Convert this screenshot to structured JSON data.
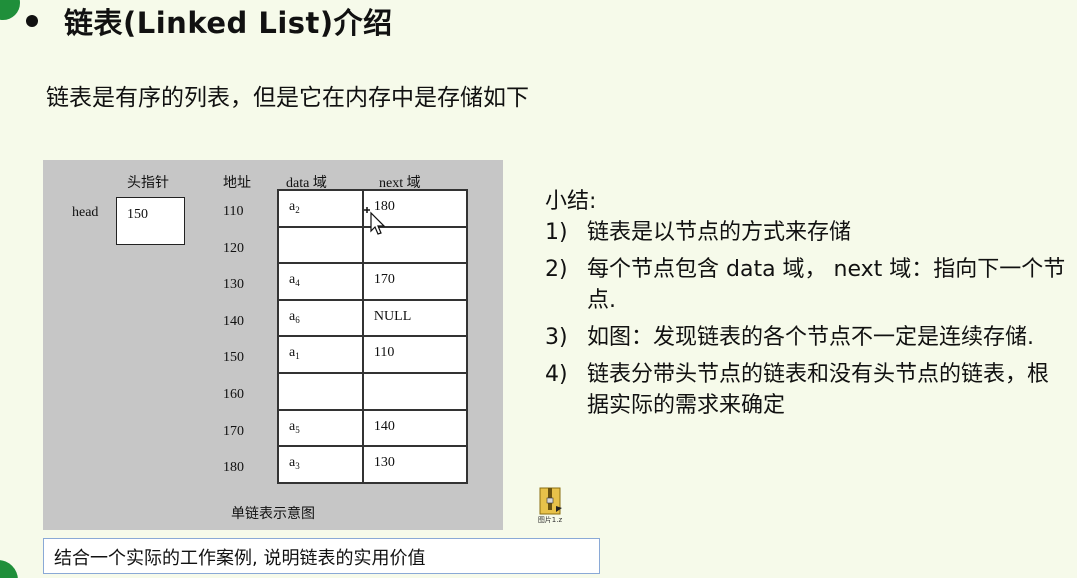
{
  "title": "链表(Linked List)介绍",
  "intro": "链表是有序的列表，但是它在内存中是存储如下",
  "diagram": {
    "head_pointer_label": "头指针",
    "address_label": "地址",
    "data_col_label": "data 域",
    "next_col_label": "next 域",
    "head_label": "head",
    "head_value": "150",
    "rows": [
      {
        "address": "110",
        "data": "a",
        "sub": "2",
        "next": "180"
      },
      {
        "address": "120",
        "data": "",
        "sub": "",
        "next": ""
      },
      {
        "address": "130",
        "data": "a",
        "sub": "4",
        "next": "170"
      },
      {
        "address": "140",
        "data": "a",
        "sub": "6",
        "next": "NULL"
      },
      {
        "address": "150",
        "data": "a",
        "sub": "1",
        "next": "110"
      },
      {
        "address": "160",
        "data": "",
        "sub": "",
        "next": ""
      },
      {
        "address": "170",
        "data": "a",
        "sub": "5",
        "next": "140"
      },
      {
        "address": "180",
        "data": "a",
        "sub": "3",
        "next": "130"
      }
    ],
    "caption": "单链表示意图"
  },
  "summary": {
    "heading": "小结:",
    "items": [
      {
        "num": "1)",
        "text": "链表是以节点的方式来存储"
      },
      {
        "num": "2)",
        "text": "每个节点包含 data 域， next 域：指向下一个节点."
      },
      {
        "num": "3)",
        "text": "如图：发现链表的各个节点不一定是连续存储."
      },
      {
        "num": "4)",
        "text": "链表分带头节点的链表和没有头节点的链表，根据实际的需求来确定"
      }
    ]
  },
  "file_label": "图片1.z",
  "note": "结合一个实际的工作案例, 说明链表的实用价值",
  "icons": {
    "cursor": "mouse-cursor-icon",
    "file": "folder-zip-icon"
  }
}
